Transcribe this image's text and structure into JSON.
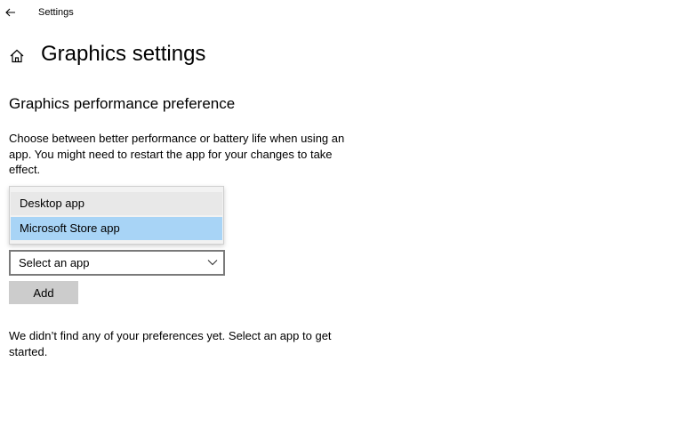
{
  "window": {
    "title": "Settings"
  },
  "header": {
    "title": "Graphics settings"
  },
  "section": {
    "heading": "Graphics performance preference",
    "description": "Choose between better performance or battery life when using an app. You might need to restart the app for your changes to take effect."
  },
  "app_type_dropdown": {
    "options": [
      "Desktop app",
      "Microsoft Store app"
    ],
    "highlighted": "Microsoft Store app"
  },
  "app_select": {
    "value": "Select an app"
  },
  "add_button": {
    "label": "Add"
  },
  "empty_state": {
    "message": "We didn’t find any of your preferences yet. Select an app to get started."
  },
  "icons": {
    "back": "back-arrow-icon",
    "home": "home-icon",
    "chevron": "chevron-down-icon"
  },
  "colors": {
    "highlight": "#a8d4f6",
    "button": "#cccccc",
    "select_border": "#7a7a7a"
  }
}
